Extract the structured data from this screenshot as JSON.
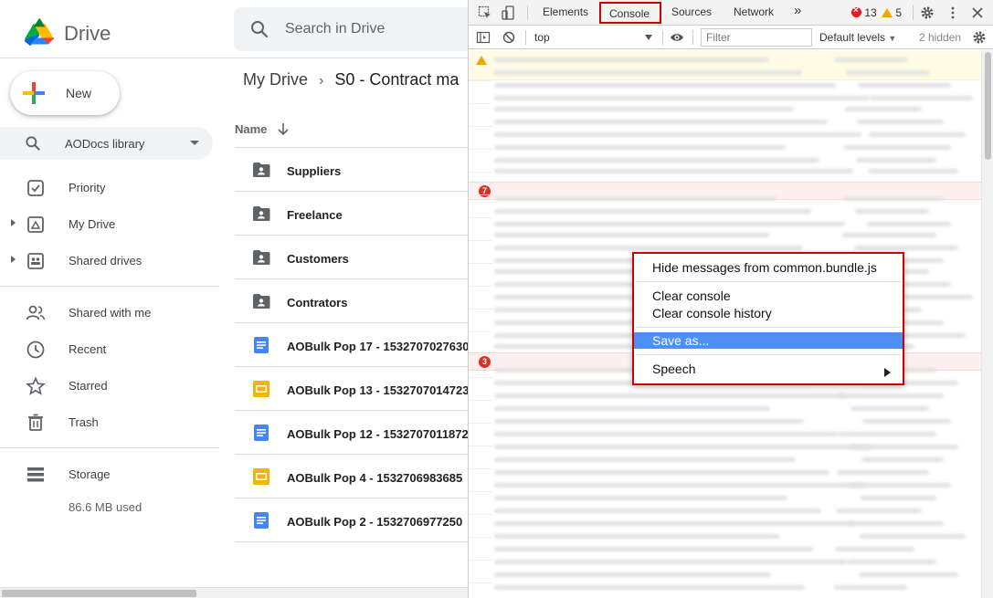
{
  "drive": {
    "brand": "Drive",
    "search": {
      "placeholder": "Search in Drive"
    },
    "new_label": "New",
    "library": {
      "label": "AODocs library"
    },
    "nav": [
      {
        "label": "Priority",
        "icon": "priority-check-icon",
        "expandable": false
      },
      {
        "label": "My Drive",
        "icon": "my-drive-icon",
        "expandable": true
      },
      {
        "label": "Shared drives",
        "icon": "shared-drives-icon",
        "expandable": true
      },
      {
        "label": "Shared with me",
        "icon": "people-icon",
        "expandable": false
      },
      {
        "label": "Recent",
        "icon": "clock-icon",
        "expandable": false
      },
      {
        "label": "Starred",
        "icon": "star-icon",
        "expandable": false
      },
      {
        "label": "Trash",
        "icon": "trash-icon",
        "expandable": false
      }
    ],
    "storage": {
      "label": "Storage",
      "used": "86.6 MB used"
    },
    "breadcrumb": {
      "root": "My Drive",
      "current": "S0 - Contract ma"
    },
    "column_header": "Name",
    "files": [
      {
        "name": "Suppliers",
        "type": "shared-folder"
      },
      {
        "name": "Freelance",
        "type": "shared-folder"
      },
      {
        "name": "Customers",
        "type": "shared-folder"
      },
      {
        "name": "Contrators",
        "type": "shared-folder"
      },
      {
        "name": "AOBulk Pop 17 - 1532707027630",
        "type": "doc"
      },
      {
        "name": "AOBulk Pop 13 - 1532707014723",
        "type": "slides"
      },
      {
        "name": "AOBulk Pop 12 - 1532707011872",
        "type": "doc"
      },
      {
        "name": "AOBulk Pop 4 - 1532706983685",
        "type": "slides"
      },
      {
        "name": "AOBulk Pop 2 - 1532706977250",
        "type": "doc"
      }
    ],
    "colors": {
      "doc": "#4285f4",
      "slides": "#f4b400",
      "folder": "#5f6368"
    }
  },
  "devtools": {
    "tabs": [
      "Elements",
      "Console",
      "Sources",
      "Network"
    ],
    "active_tab": "Console",
    "more_tabs": "»",
    "errors": "13",
    "warnings": "5",
    "context": "top",
    "filter_placeholder": "Filter",
    "levels": "Default levels",
    "hidden": "2 hidden",
    "error_group_counts": [
      "7",
      "3"
    ],
    "context_menu": {
      "items": [
        {
          "label": "Hide messages from common.bundle.js",
          "selected": false
        },
        {
          "label": "Clear console",
          "selected": false
        },
        {
          "label": "Clear console history",
          "selected": false
        },
        {
          "label": "Save as...",
          "selected": true
        },
        {
          "label": "Speech",
          "selected": false,
          "submenu": true
        }
      ]
    },
    "colors": {
      "highlight": "#d10000",
      "selection": "#4e8ff5"
    }
  }
}
